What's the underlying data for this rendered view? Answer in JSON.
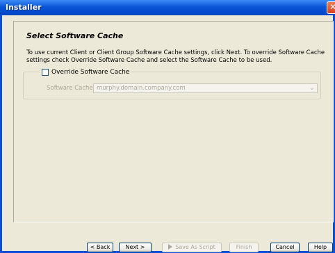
{
  "window": {
    "title": "Installer",
    "close_symbol": "✕"
  },
  "page": {
    "heading": "Select Software Cache",
    "description": "To use current Client or Client Group Software Cache settings, click Next. To override Software Cache settings check Override Software Cache and select the Software Cache to be used."
  },
  "override": {
    "label": "Override Software Cache",
    "checked": false
  },
  "cache": {
    "label": "Software Cache:",
    "value": "murphy.domain.company.com",
    "arrow": "⌄"
  },
  "buttons": {
    "back": "< Back",
    "next": "Next >",
    "save_script": "Save As Script",
    "finish": "Finish",
    "cancel": "Cancel",
    "help": "Help"
  },
  "colors": {
    "titlebar": "#0a55d8",
    "background": "#ece9d8",
    "close": "#d4411f"
  }
}
